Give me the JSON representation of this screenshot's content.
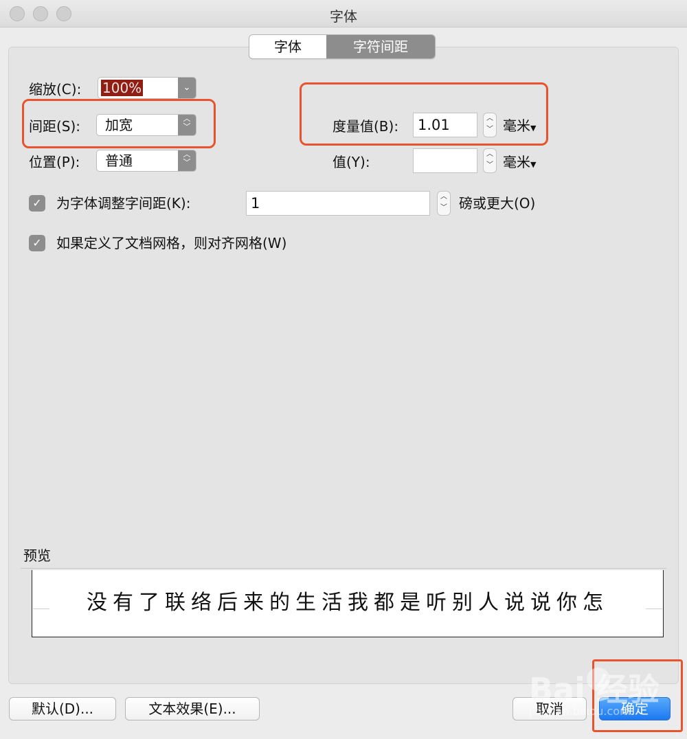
{
  "window": {
    "title": "字体"
  },
  "tabs": [
    {
      "label": "字体",
      "active": false
    },
    {
      "label": "字符间距",
      "active": true
    }
  ],
  "scale": {
    "label": "缩放(C):",
    "value": "100%"
  },
  "spacing": {
    "label": "间距(S):",
    "value": "加宽"
  },
  "position": {
    "label": "位置(P):",
    "value": "普通"
  },
  "measure_by": {
    "label": "度量值(B):",
    "value": "1.01",
    "unit": "毫米"
  },
  "measure_y": {
    "label": "值(Y):",
    "value": "",
    "unit": "毫米"
  },
  "kerning": {
    "label": "为字体调整字间距(K):",
    "value": "1",
    "suffix": "磅或更大(O)",
    "checked": true
  },
  "grid_snap": {
    "label": "如果定义了文档网格，则对齐网格(W)",
    "checked": true
  },
  "preview": {
    "label": "预览",
    "text": "没有了联络后来的生活我都是听别人说说你怎"
  },
  "buttons": {
    "default": "默认(D)...",
    "text_effects": "文本效果(E)...",
    "cancel": "取消",
    "ok": "确定"
  },
  "watermark": {
    "text": "Bai 经验",
    "sub": "jingyan.baidu.com"
  },
  "colors": {
    "highlight": "#e8522c",
    "primary_button": "#1b79f0",
    "selection": "#8e1f12"
  }
}
